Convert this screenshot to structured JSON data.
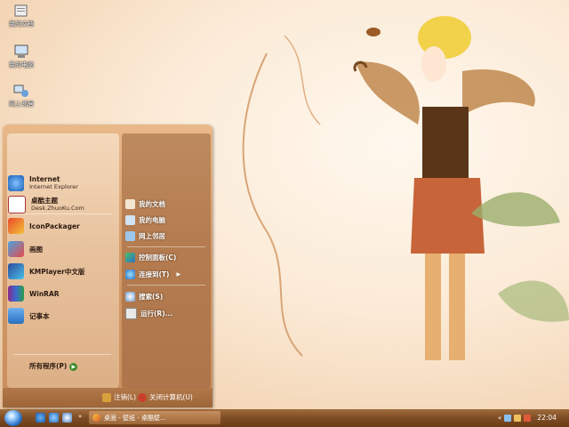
{
  "desktop_icons": [
    {
      "name": "my-documents",
      "label": "我的文档"
    },
    {
      "name": "my-computer",
      "label": "我的电脑"
    },
    {
      "name": "network-places",
      "label": "网上邻居"
    }
  ],
  "start_menu": {
    "pinned": [
      {
        "title": "Internet",
        "subtitle": "Internet Explorer",
        "icon": "internet-explorer-icon"
      },
      {
        "title": "桌酷主题",
        "subtitle": "Desk.ZhuoKu.Com",
        "icon": "zhuoku-icon"
      }
    ],
    "recent": [
      {
        "title": "IconPackager",
        "icon": "iconpackager-icon"
      },
      {
        "title": "画图",
        "icon": "paint-icon"
      },
      {
        "title": "KMPlayer中文版",
        "icon": "kmplayer-icon"
      },
      {
        "title": "WinRAR",
        "icon": "winrar-icon"
      },
      {
        "title": "记事本",
        "icon": "notepad-icon"
      }
    ],
    "all_programs": "所有程序(P)",
    "right_items": [
      {
        "label": "我的文档",
        "icon": "documents-icon"
      },
      {
        "label": "我的电脑",
        "icon": "computer-icon"
      },
      {
        "label": "网上邻居",
        "icon": "network-icon"
      },
      {
        "label": "控制面板(C)",
        "icon": "control-panel-icon"
      },
      {
        "label": "连接到(T)",
        "icon": "connect-icon"
      },
      {
        "label": "搜索(S)",
        "icon": "search-icon"
      },
      {
        "label": "运行(R)...",
        "icon": "run-icon"
      }
    ],
    "logoff": "注销(L)",
    "shutdown": "关闭计算机(U)"
  },
  "taskbar": {
    "task_label": "桌面 - 壁纸 - 桌酷壁...",
    "clock": "22:04"
  }
}
